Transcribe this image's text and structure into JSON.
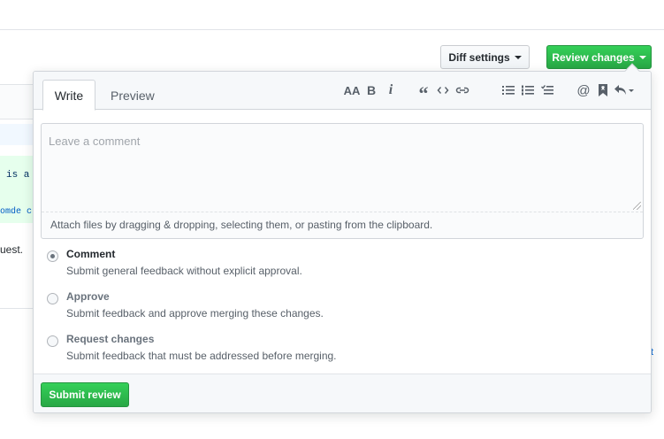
{
  "background": {
    "code_line_1": "is a",
    "code_line_2": "omde c",
    "text_fragment": "uest.",
    "right_link_fragment": "t"
  },
  "header_buttons": {
    "diff_settings_label": "Diff settings",
    "review_changes_label": "Review changes"
  },
  "review_form": {
    "tabs": [
      {
        "label": "Write",
        "active": true
      },
      {
        "label": "Preview",
        "active": false
      }
    ],
    "toolbar": {
      "groups": [
        [
          "text-size-icon",
          "bold-icon",
          "italic-icon"
        ],
        [
          "quote-icon",
          "code-icon",
          "link-icon"
        ],
        [
          "unordered-list-icon",
          "ordered-list-icon",
          "task-list-icon"
        ],
        [
          "mention-icon",
          "bookmark-icon",
          "reply-icon"
        ]
      ],
      "text_size_glyph": "AA",
      "bold_glyph": "B",
      "italic_glyph": "i",
      "quote_glyph": "“",
      "mention_glyph": "@"
    },
    "comment_placeholder": "Leave a comment",
    "attach_hint": "Attach files by dragging & dropping, selecting them, or pasting from the clipboard.",
    "options": [
      {
        "label": "Comment",
        "description": "Submit general feedback without explicit approval.",
        "checked": true
      },
      {
        "label": "Approve",
        "description": "Submit feedback and approve merging these changes.",
        "checked": false
      },
      {
        "label": "Request changes",
        "description": "Submit feedback that must be addressed before merging.",
        "checked": false
      }
    ],
    "submit_label": "Submit review"
  },
  "colors": {
    "primary_green": "#28a745",
    "border": "#d1d5da",
    "muted_text": "#586069"
  }
}
